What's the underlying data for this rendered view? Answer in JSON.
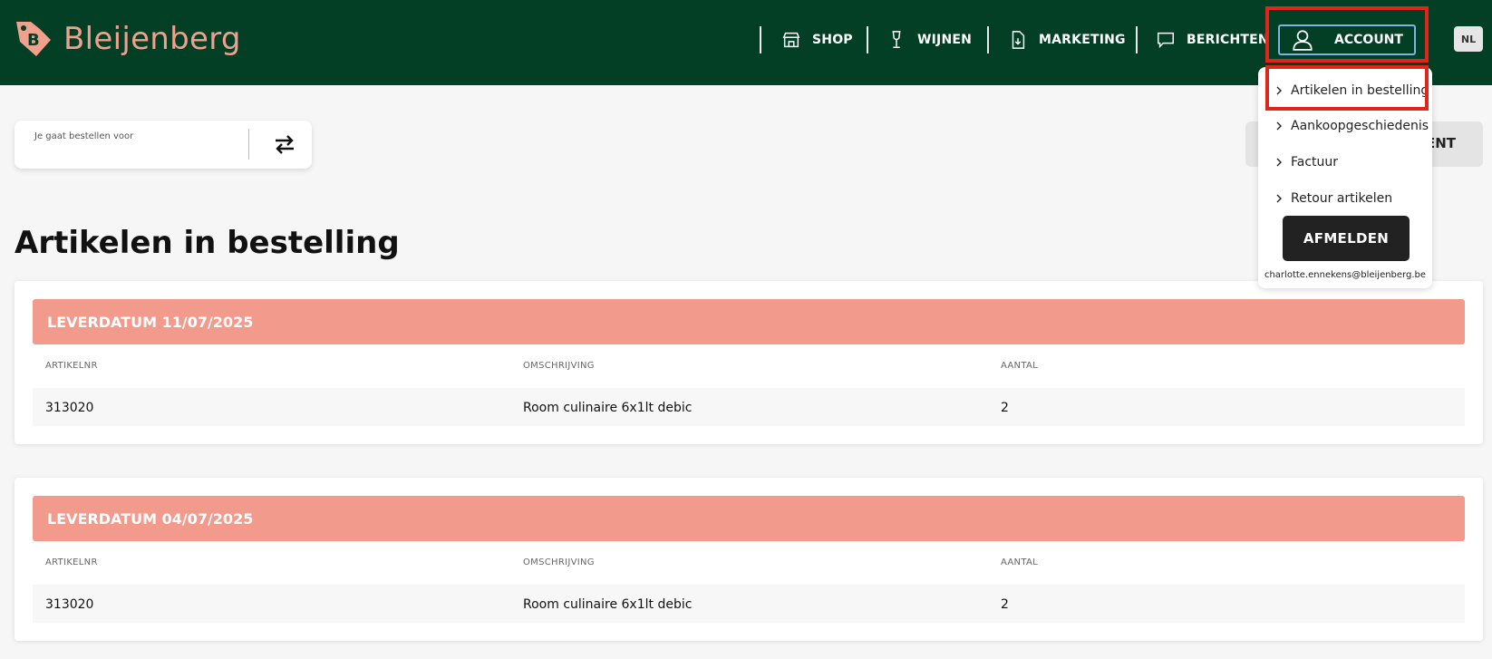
{
  "brand": {
    "name": "Bleijenberg"
  },
  "nav": {
    "shop": "SHOP",
    "wijnen": "WIJNEN",
    "marketing": "MARKETING",
    "berichten": "BERICHTEN",
    "account": "ACCOUNT",
    "lang": "NL"
  },
  "account_menu": {
    "items": [
      {
        "label": "Artikelen in bestelling"
      },
      {
        "label": "Aankoopgeschiedenis"
      },
      {
        "label": "Factuur"
      },
      {
        "label": "Retour artikelen"
      }
    ],
    "logout_label": "AFMELDEN",
    "email": "charlotte.ennekens@bleijenberg.be"
  },
  "order_for": {
    "label": "Je gaat bestellen voor"
  },
  "right_button_partial": "ENT",
  "page_title": "Artikelen in bestelling",
  "columns": {
    "artikelnr": "ARTIKELNR",
    "omschrijving": "OMSCHRIJVING",
    "aantal": "AANTAL"
  },
  "orders": [
    {
      "header": "LEVERDATUM 11/07/2025",
      "rows": [
        {
          "artikelnr": "313020",
          "omschrijving": "Room culinaire 6x1lt debic",
          "aantal": "2"
        }
      ]
    },
    {
      "header": "LEVERDATUM 04/07/2025",
      "rows": [
        {
          "artikelnr": "313020",
          "omschrijving": "Room culinaire 6x1lt debic",
          "aantal": "2"
        }
      ]
    }
  ],
  "colors": {
    "header_bg": "#033f25",
    "brand_salmon": "#f0a08d",
    "order_header": "#f29a8c",
    "highlight": "#e0261c"
  }
}
